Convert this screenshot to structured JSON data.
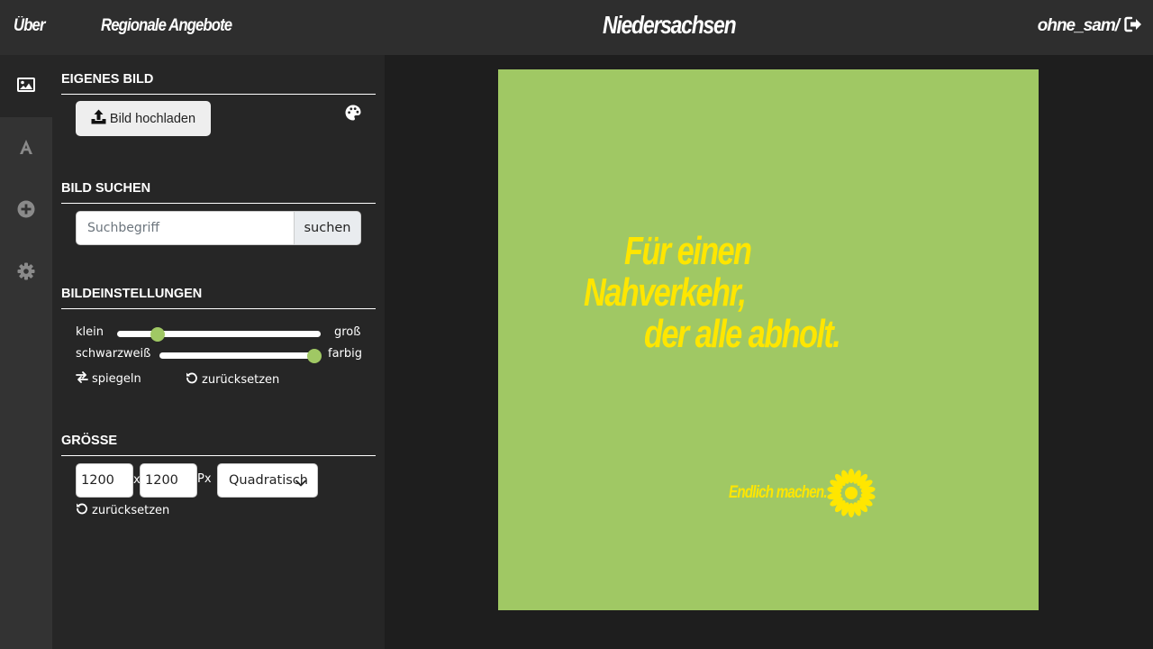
{
  "nav": {
    "about": "Über",
    "regional": "Regionale Angebote",
    "brand": "Niedersachsen",
    "user": "ohne_sam/"
  },
  "rail": {
    "items": [
      {
        "icon": "image-icon",
        "active": true
      },
      {
        "icon": "text-icon",
        "active": false
      },
      {
        "icon": "plus-circle-icon",
        "active": false
      },
      {
        "icon": "gear-icon",
        "active": false
      }
    ]
  },
  "sections": {
    "own_image": {
      "title": "EIGENES BILD",
      "upload_label": "Bild hochladen"
    },
    "search": {
      "title": "BILD SUCHEN",
      "placeholder": "Suchbegriff",
      "button": "suchen"
    },
    "image_settings": {
      "title": "BILDEINSTELLUNGEN",
      "size_min": "klein",
      "size_max": "groß",
      "size_value": 0.2,
      "color_min": "schwarzweiß",
      "color_max": "farbig",
      "color_value": 1.0,
      "mirror": "spiegeln",
      "reset": "zurücksetzen"
    },
    "size": {
      "title": "GRÖSSE",
      "width": "1200",
      "height": "1200",
      "separator": "x",
      "unit": "Px",
      "format": "Quadratisch",
      "reset": "zurücksetzen"
    }
  },
  "canvas": {
    "background": "#a0c864",
    "text_color": "#ffe600",
    "headline": [
      "Für einen",
      "Nahverkehr,",
      "der alle abholt."
    ],
    "tagline": "Endlich machen."
  },
  "colors": {
    "topbar": "#2e2e2e",
    "rail": "#333333",
    "panel": "#262626",
    "accent": "#a0c864"
  }
}
